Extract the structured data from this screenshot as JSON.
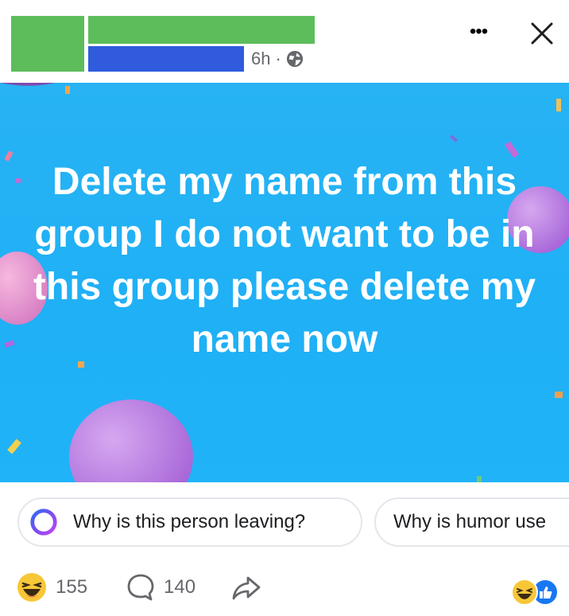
{
  "header": {
    "timestamp": "6h",
    "separator": "·",
    "privacy_icon": "globe-icon",
    "more_icon": "more-horizontal-icon",
    "more_label": "•••",
    "close_icon": "close-icon",
    "redaction_colors": {
      "author": "#5cbd5a",
      "group": "#2f5bdc"
    }
  },
  "post": {
    "text": "Delete my name from this group I do not want to be in this group please delete my name now",
    "background": "#1fb0f5",
    "decoration": "balloons-and-confetti"
  },
  "ai_prompts": [
    {
      "label": "Why is this person leaving?",
      "icon": "meta-ai-ring-icon"
    },
    {
      "label": "Why is humor use"
    }
  ],
  "footer": {
    "reaction_icon": "haha-emoji-icon",
    "reactions_count": "155",
    "comment_icon": "comment-bubble-icon",
    "comments_count": "140",
    "share_icon": "share-arrow-icon",
    "summary_icons": [
      "haha-emoji-icon",
      "like-thumb-icon"
    ]
  }
}
